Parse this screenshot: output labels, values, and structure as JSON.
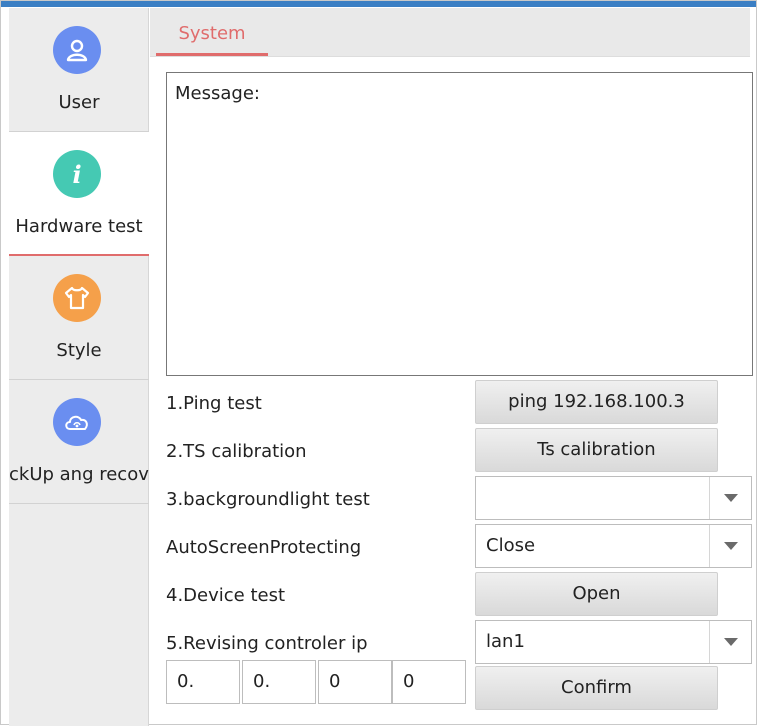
{
  "sidebar": {
    "items": [
      {
        "label": "User",
        "icon": "user-icon",
        "color": "#6a8ef0"
      },
      {
        "label": "Hardware test",
        "icon": "info-icon",
        "color": "#45c9b3"
      },
      {
        "label": "Style",
        "icon": "shirt-icon",
        "color": "#f5a04a"
      },
      {
        "label": "ckUp ang recov",
        "icon": "cloud-sync-icon",
        "color": "#6a8ef0"
      }
    ]
  },
  "tab": {
    "label": "System"
  },
  "message": {
    "label": "Message:"
  },
  "rows": {
    "ping": {
      "label": "1.Ping test",
      "button": "ping 192.168.100.3"
    },
    "ts": {
      "label": "2.TS calibration",
      "button": "Ts calibration"
    },
    "backlight": {
      "label": "3.backgroundlight test",
      "value": ""
    },
    "autoscreen": {
      "label": "AutoScreenProtecting",
      "value": "Close"
    },
    "device": {
      "label": "4.Device test",
      "button": "Open"
    },
    "revise": {
      "label": "5.Revising controler ip",
      "value": "lan1"
    }
  },
  "ip": {
    "octets": [
      "0.",
      "0.",
      "0",
      "0"
    ],
    "confirm": "Confirm"
  },
  "colors": {
    "accent": "#e06c6c",
    "active_indicator": "#e06c6c"
  }
}
